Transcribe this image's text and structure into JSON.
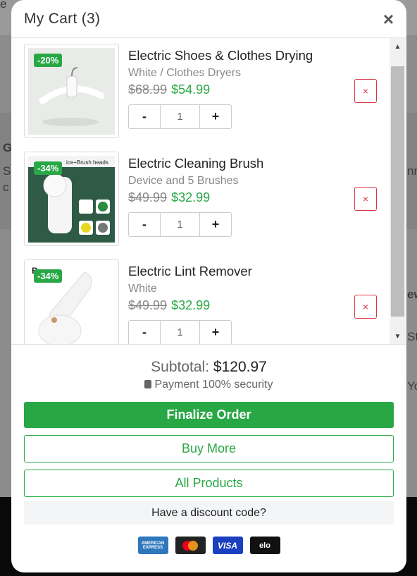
{
  "background": {
    "frag_top": "e",
    "frag_g": "G",
    "frag_s": "S",
    "frag_c": "c",
    "frag_nn": "nn",
    "frag_ew": "ew",
    "frag_st": "St",
    "frag_yo": "Yo"
  },
  "cart": {
    "title": "My Cart (3)",
    "close_label": "×",
    "items": [
      {
        "discount": "-20%",
        "name": "Electric Shoes & Clothes Drying",
        "variant": "White / Clothes Dryers",
        "old_price": "$68.99",
        "new_price": "$54.99",
        "qty": "1",
        "minus": "-",
        "plus": "+",
        "remove": "×"
      },
      {
        "discount": "-34%",
        "name": "Electric Cleaning Brush",
        "variant": "Device and 5 Brushes",
        "old_price": "$49.99",
        "new_price": "$32.99",
        "qty": "1",
        "minus": "-",
        "plus": "+",
        "remove": "×",
        "image_text": "ice+Brush heads"
      },
      {
        "discount": "-34%",
        "name": "Electric Lint Remover",
        "variant": "White",
        "old_price": "$49.99",
        "new_price": "$32.99",
        "qty": "1",
        "minus": "-",
        "plus": "+",
        "remove": "×",
        "image_text": "B"
      }
    ],
    "subtotal_label": "Subtotal:",
    "subtotal_value": "$120.97",
    "security": "Payment 100% security",
    "finalize": "Finalize Order",
    "buy_more": "Buy More",
    "all_products": "All Products",
    "discount_code": "Have a discount code?",
    "payments": [
      "AMERICAN EXPRESS",
      "",
      "VISA",
      "elo"
    ],
    "colors": {
      "accent": "#28a745",
      "danger": "#dc3545"
    }
  }
}
